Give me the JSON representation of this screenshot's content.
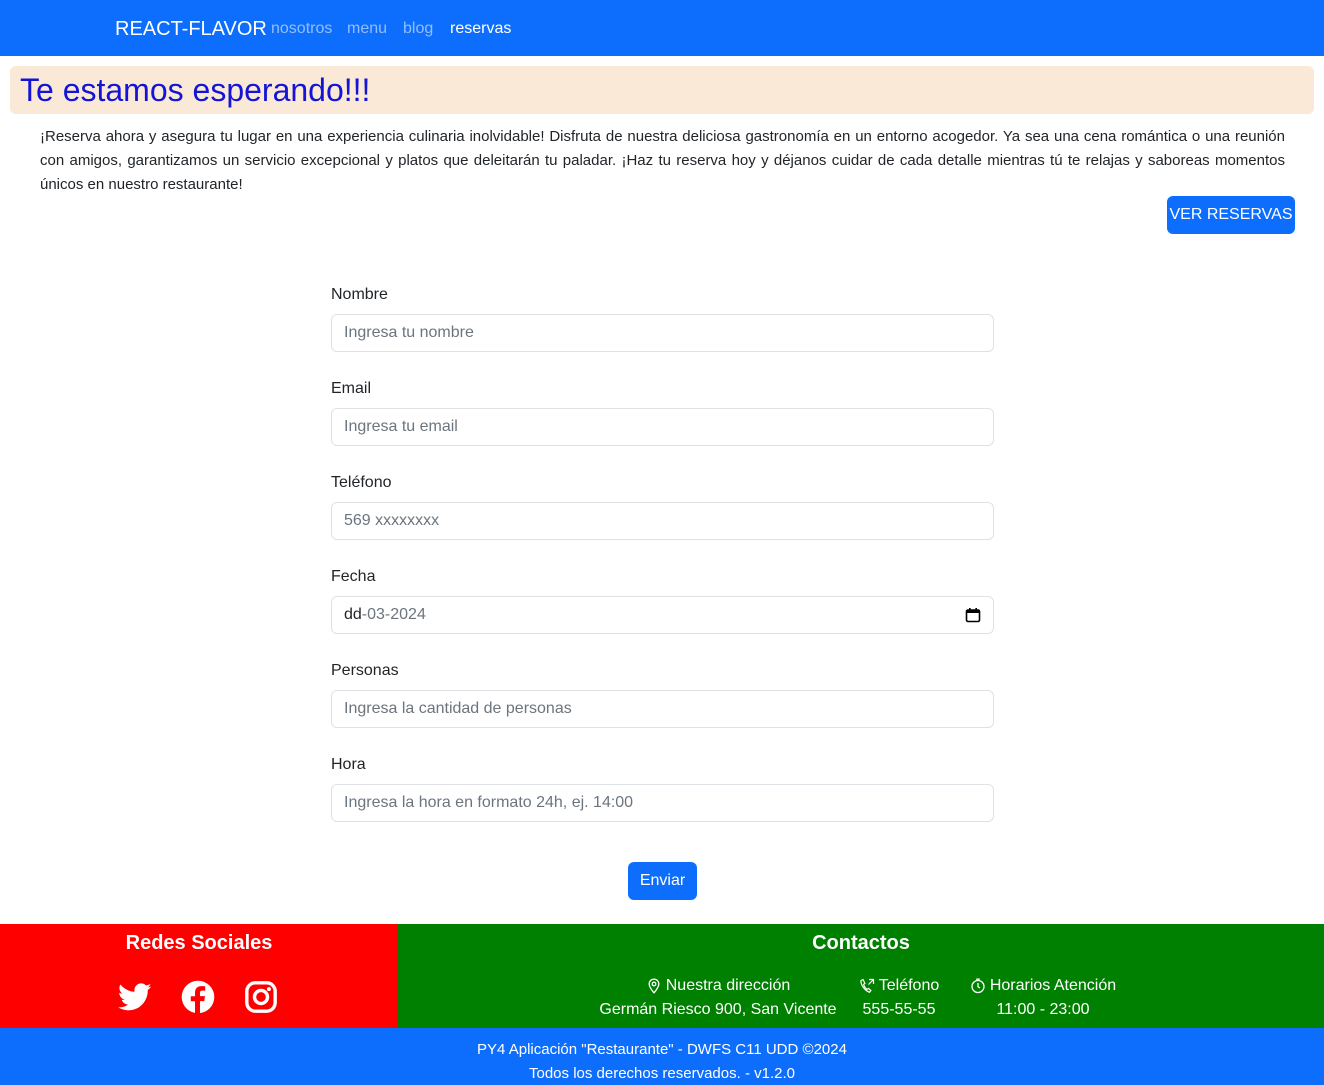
{
  "navbar": {
    "brand": "REACT-FLAVOR",
    "links": [
      {
        "label": "nosotros",
        "active": false
      },
      {
        "label": "menu",
        "active": false
      },
      {
        "label": "blog",
        "active": false
      },
      {
        "label": "reservas",
        "active": true
      }
    ]
  },
  "hero": {
    "title": "Te estamos esperando!!!"
  },
  "intro": {
    "text": "¡Reserva ahora y asegura tu lugar en una experiencia culinaria inolvidable! Disfruta de nuestra deliciosa gastronomía en un entorno acogedor. Ya sea una cena romántica o una reunión con amigos, garantizamos un servicio excepcional y platos que deleitarán tu paladar. ¡Haz tu reserva hoy y déjanos cuidar de cada detalle mientras tú te relajas y saboreas momentos únicos en nuestro restaurante!",
    "button_label": "VER RESERVAS"
  },
  "form": {
    "nombre": {
      "label": "Nombre",
      "placeholder": "Ingresa tu nombre"
    },
    "email": {
      "label": "Email",
      "placeholder": "Ingresa tu email"
    },
    "telefono": {
      "label": "Teléfono",
      "placeholder": "569 xxxxxxxx"
    },
    "fecha": {
      "label": "Fecha",
      "day": "dd",
      "rest": "-03-2024"
    },
    "personas": {
      "label": "Personas",
      "placeholder": "Ingresa la cantidad de personas"
    },
    "hora": {
      "label": "Hora",
      "placeholder": "Ingresa la hora en formato 24h, ej. 14:00"
    },
    "submit_label": "Enviar"
  },
  "footer": {
    "social": {
      "title": "Redes Sociales",
      "icons": [
        "twitter-icon",
        "facebook-icon",
        "instagram-icon"
      ],
      "bg_color": "#ff0000"
    },
    "contacts": {
      "title": "Contactos",
      "bg_color": "#008000",
      "address": {
        "label": "Nuestra dirección",
        "value": "Germán Riesco 900, San Vicente",
        "icon": "map-pin-icon"
      },
      "phone": {
        "label": "Teléfono",
        "value": "555-55-55",
        "icon": "phone-icon"
      },
      "hours": {
        "label": "Horarios Atención",
        "value": "11:00 - 23:00",
        "icon": "clock-icon"
      }
    },
    "copyright": {
      "line1": "PY4 Aplicación \"Restaurante\" - DWFS C11 UDD ©2024",
      "line2": "Todos los derechos reservados. - v1.2.0"
    }
  },
  "colors": {
    "primary": "#0d6efd",
    "hero_bg": "#fae9d6",
    "hero_title": "#1414d6"
  }
}
